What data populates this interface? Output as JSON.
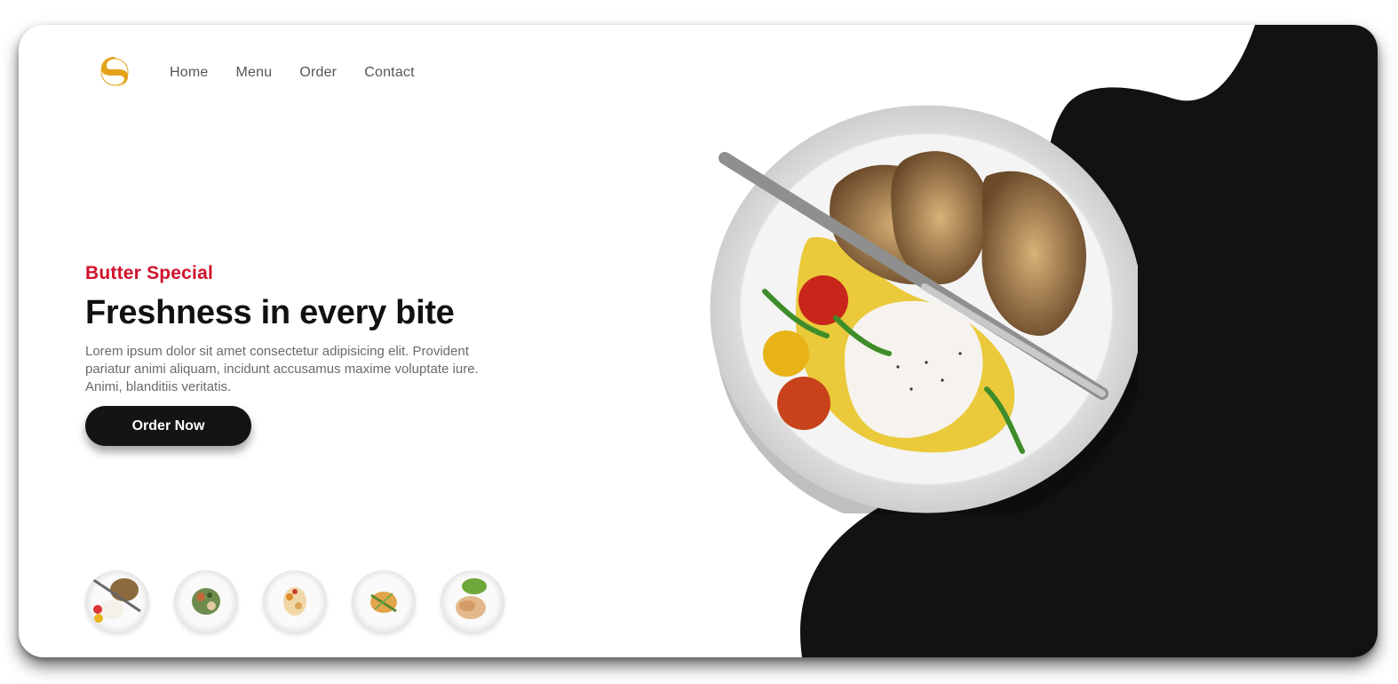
{
  "brand": {
    "logo_icon": "fork-spoon-logo-icon",
    "accent": "#e3a21a"
  },
  "nav": {
    "items": [
      "Home",
      "Menu",
      "Order",
      "Contact"
    ]
  },
  "hero": {
    "kicker": "Butter Special",
    "title": "Freshness in every bite",
    "description": "Lorem ipsum dolor sit amet consectetur adipisicing elit. Provident pariatur animi aliquam, incidunt accusamus maxime voluptate iure. Animi, blanditiis veritatis.",
    "cta_label": "Order Now"
  },
  "colors": {
    "kicker": "#d0112b",
    "dark": "#121213",
    "button": "#141414"
  },
  "gallery": {
    "items": [
      "bread-burrata-plate",
      "salad-plate",
      "pasta-plate",
      "grilled-fish-plate",
      "chicken-lettuce-plate"
    ]
  }
}
